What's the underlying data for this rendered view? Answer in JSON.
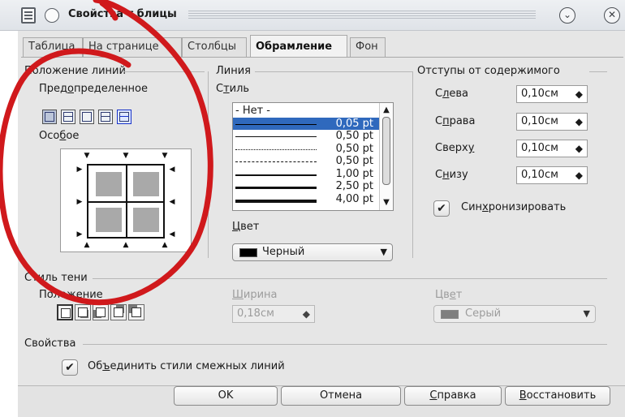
{
  "window": {
    "title": "Свойства таблицы",
    "title_visible": "Свойства т блицы"
  },
  "tabs": [
    {
      "label": "Таблица"
    },
    {
      "label": "На странице"
    },
    {
      "label": "Столбцы"
    },
    {
      "label": "Обрамление",
      "active": true
    },
    {
      "label": "Фон"
    }
  ],
  "line_arrangement": {
    "label": "Положение линий",
    "preset_label": "Предопределенное",
    "preset_label_u": "о",
    "preset_icons": [
      "no-borders-icon",
      "outer-border-icon",
      "outer-horizontal-icon",
      "outer-inner-horizontal-icon",
      "all-borders-icon"
    ],
    "custom_label": "Особое",
    "custom_label_u": "б"
  },
  "line": {
    "label": "Линия",
    "style_label": "Стиль",
    "styles": [
      {
        "label": "- Нет -",
        "width": 0,
        "dash": "none"
      },
      {
        "label": "0,05 pt",
        "width": 1,
        "dash": "solid",
        "selected": true
      },
      {
        "label": "0,50 pt",
        "width": 1.5,
        "dash": "solid"
      },
      {
        "label": "0,50 pt",
        "width": 1,
        "dash": "dotted"
      },
      {
        "label": "0,50 pt",
        "width": 1,
        "dash": "dashed"
      },
      {
        "label": "1,00 pt",
        "width": 2,
        "dash": "solid"
      },
      {
        "label": "2,50 pt",
        "width": 3,
        "dash": "solid"
      },
      {
        "label": "4,00 pt",
        "width": 4,
        "dash": "solid"
      }
    ],
    "color_label": "Цвет",
    "color_value": "Черный",
    "color_swatch": "#000000"
  },
  "spacing": {
    "label": "Отступы от содержимого",
    "left_label": "Слева",
    "left_value": "0,10см",
    "right_label": "Справа",
    "right_value": "0,10см",
    "top_label": "Сверху",
    "top_value": "0,10см",
    "bottom_label": "Снизу",
    "bottom_value": "0,10см",
    "sync_label": "Синхронизировать",
    "sync_checked": true
  },
  "shadow": {
    "label": "Стиль тени",
    "position_label": "Положение",
    "position_icons": [
      "no-shadow-icon",
      "shadow-bottom-right-icon",
      "shadow-bottom-left-icon",
      "shadow-top-right-icon",
      "shadow-top-left-icon"
    ],
    "width_label": "Ширина",
    "width_value": "0,18см",
    "color_label": "Цвет",
    "color_value": "Серый",
    "color_swatch": "#7f7f7f"
  },
  "properties": {
    "label": "Свойства",
    "merge_label": "Объединить стили смежных линий",
    "merge_checked": true
  },
  "buttons": {
    "ok": "OK",
    "cancel": "Отмена",
    "help": "Справка",
    "reset": "Восстановить"
  },
  "annotation_color": "#d0191c"
}
